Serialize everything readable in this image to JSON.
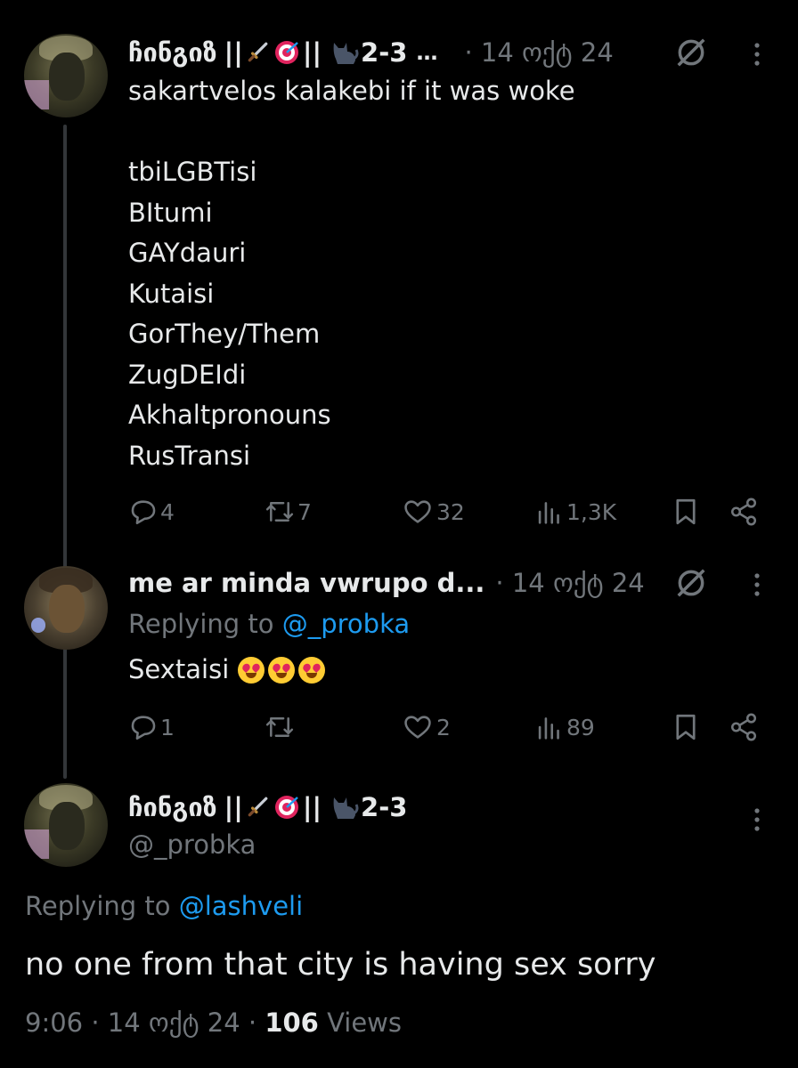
{
  "tweet1": {
    "display_name": "ჩინგიზ",
    "name_separator": "||",
    "name_suffix": "2-3",
    "ellipsis": "…",
    "time": "· 14 ოქტ 24",
    "text_lines": [
      "sakartvelos kalakebi if it was woke",
      "",
      "tbiLGBTisi",
      "BItumi",
      "GAYdauri",
      "Kutaisi",
      "GorThey/Them",
      "ZugDEIdi",
      "Akhaltpronouns",
      "RusTransi"
    ],
    "replies": "4",
    "reposts": "7",
    "likes": "32",
    "views": "1,3K"
  },
  "tweet2": {
    "display_name": "me ar minda vwrupo d...",
    "time": "· 14 ოქტ 24",
    "replying_prefix": "Replying to",
    "replying_to": "@_probka",
    "text": "Sextaisi",
    "replies": "1",
    "reposts": "",
    "likes": "2",
    "views": "89"
  },
  "main": {
    "display_name": "ჩინგიზ",
    "name_separator": "||",
    "name_suffix": "2-3",
    "handle": "@_probka",
    "replying_prefix": "Replying to",
    "replying_to": "@lashveli",
    "text": "no one from that city is having sex sorry",
    "timestamp": "9:06 · 14 ოქტ 24 ·",
    "views_count": "106",
    "views_label": "Views"
  },
  "colors": {
    "background": "#000000",
    "text": "#e7e9ea",
    "muted": "#71767b",
    "link": "#1d9bf0"
  },
  "icons": [
    "reply-icon",
    "repost-icon",
    "like-icon",
    "views-icon",
    "bookmark-icon",
    "share-icon",
    "more-icon",
    "grok-icon",
    "dagger-icon",
    "target-icon",
    "cat-icon",
    "heart-eyes-emoji"
  ]
}
